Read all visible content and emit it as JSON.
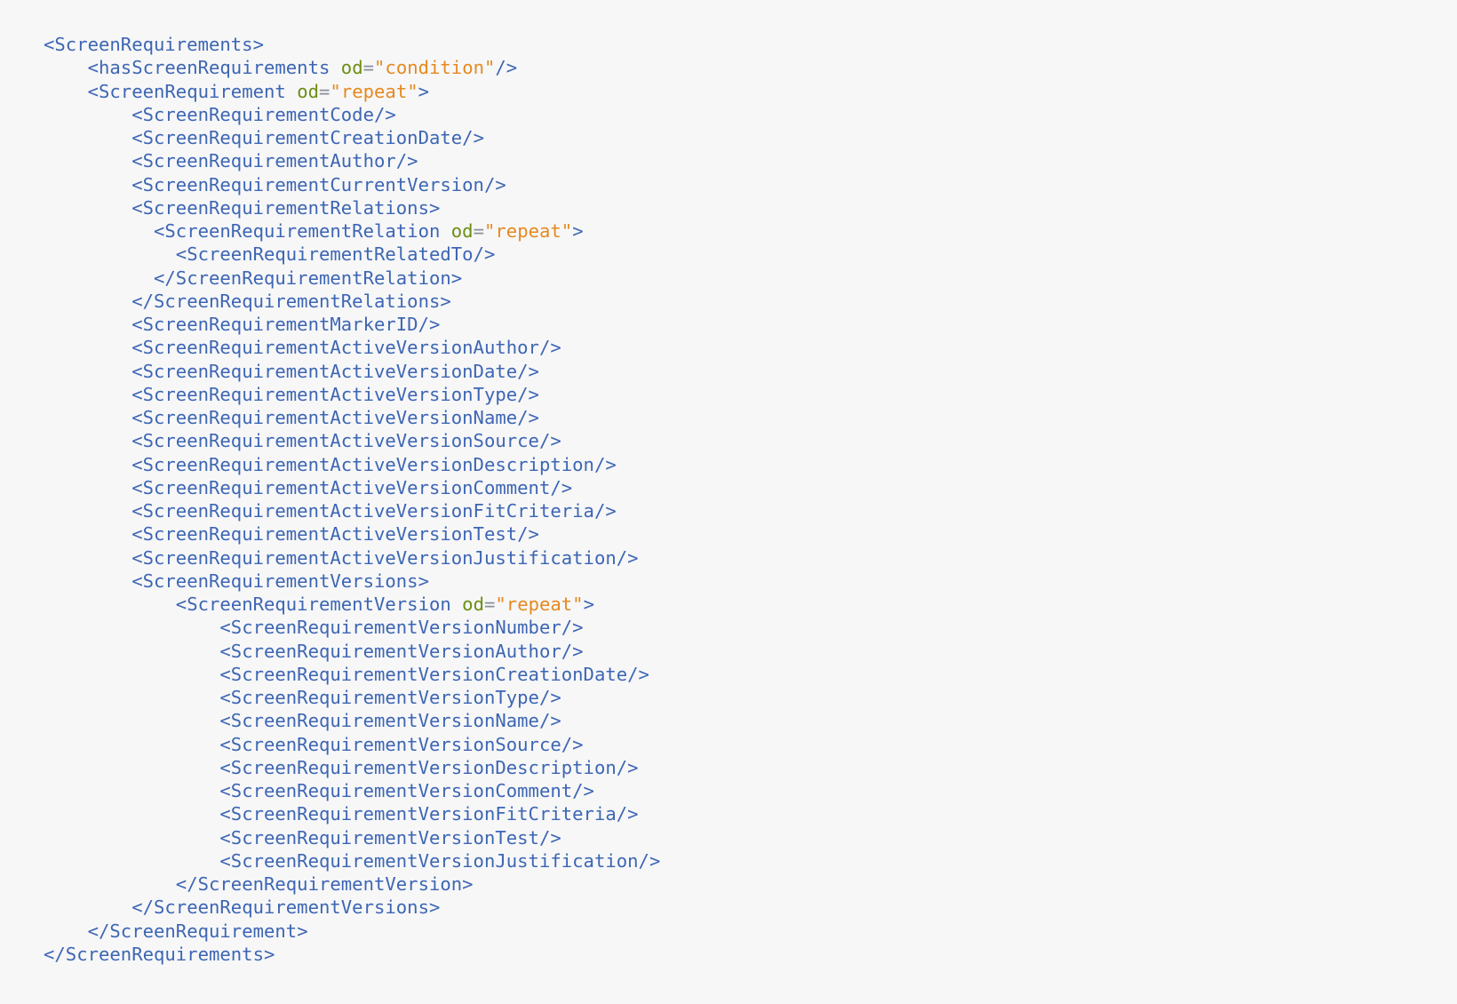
{
  "colors": {
    "background": "#f7f7f8",
    "tag": "#3d66b3",
    "attribute": "#6b8e12",
    "equals": "#8a8f99",
    "value": "#e6891f"
  },
  "code": {
    "language": "xml",
    "lines": [
      {
        "indent": 0,
        "open": "<ScreenRequirements",
        "close": ">"
      },
      {
        "indent": 4,
        "open": "<hasScreenRequirements",
        "attr": "od",
        "value": "\"condition\"",
        "close": "/>"
      },
      {
        "indent": 4,
        "open": "<ScreenRequirement",
        "attr": "od",
        "value": "\"repeat\"",
        "close": ">"
      },
      {
        "indent": 8,
        "open": "<ScreenRequirementCode",
        "close": "/>"
      },
      {
        "indent": 8,
        "open": "<ScreenRequirementCreationDate",
        "close": "/>"
      },
      {
        "indent": 8,
        "open": "<ScreenRequirementAuthor",
        "close": "/>"
      },
      {
        "indent": 8,
        "open": "<ScreenRequirementCurrentVersion",
        "close": "/>"
      },
      {
        "indent": 8,
        "open": "<ScreenRequirementRelations",
        "close": ">"
      },
      {
        "indent": 10,
        "open": "<ScreenRequirementRelation",
        "attr": "od",
        "value": "\"repeat\"",
        "close": ">"
      },
      {
        "indent": 12,
        "open": "<ScreenRequirementRelatedTo",
        "close": "/>"
      },
      {
        "indent": 10,
        "open": "</ScreenRequirementRelation",
        "close": ">"
      },
      {
        "indent": 8,
        "open": "</ScreenRequirementRelations",
        "close": ">"
      },
      {
        "indent": 8,
        "open": "<ScreenRequirementMarkerID",
        "close": "/>"
      },
      {
        "indent": 8,
        "open": "<ScreenRequirementActiveVersionAuthor",
        "close": "/>"
      },
      {
        "indent": 8,
        "open": "<ScreenRequirementActiveVersionDate",
        "close": "/>"
      },
      {
        "indent": 8,
        "open": "<ScreenRequirementActiveVersionType",
        "close": "/>"
      },
      {
        "indent": 8,
        "open": "<ScreenRequirementActiveVersionName",
        "close": "/>"
      },
      {
        "indent": 8,
        "open": "<ScreenRequirementActiveVersionSource",
        "close": "/>"
      },
      {
        "indent": 8,
        "open": "<ScreenRequirementActiveVersionDescription",
        "close": "/>"
      },
      {
        "indent": 8,
        "open": "<ScreenRequirementActiveVersionComment",
        "close": "/>"
      },
      {
        "indent": 8,
        "open": "<ScreenRequirementActiveVersionFitCriteria",
        "close": "/>"
      },
      {
        "indent": 8,
        "open": "<ScreenRequirementActiveVersionTest",
        "close": "/>"
      },
      {
        "indent": 8,
        "open": "<ScreenRequirementActiveVersionJustification",
        "close": "/>"
      },
      {
        "indent": 8,
        "open": "<ScreenRequirementVersions",
        "close": ">"
      },
      {
        "indent": 12,
        "open": "<ScreenRequirementVersion",
        "attr": "od",
        "value": "\"repeat\"",
        "close": ">"
      },
      {
        "indent": 16,
        "open": "<ScreenRequirementVersionNumber",
        "close": "/>"
      },
      {
        "indent": 16,
        "open": "<ScreenRequirementVersionAuthor",
        "close": "/>"
      },
      {
        "indent": 16,
        "open": "<ScreenRequirementVersionCreationDate",
        "close": "/>"
      },
      {
        "indent": 16,
        "open": "<ScreenRequirementVersionType",
        "close": "/>"
      },
      {
        "indent": 16,
        "open": "<ScreenRequirementVersionName",
        "close": "/>"
      },
      {
        "indent": 16,
        "open": "<ScreenRequirementVersionSource",
        "close": "/>"
      },
      {
        "indent": 16,
        "open": "<ScreenRequirementVersionDescription",
        "close": "/>"
      },
      {
        "indent": 16,
        "open": "<ScreenRequirementVersionComment",
        "close": "/>"
      },
      {
        "indent": 16,
        "open": "<ScreenRequirementVersionFitCriteria",
        "close": "/>"
      },
      {
        "indent": 16,
        "open": "<ScreenRequirementVersionTest",
        "close": "/>"
      },
      {
        "indent": 16,
        "open": "<ScreenRequirementVersionJustification",
        "close": "/>"
      },
      {
        "indent": 12,
        "open": "</ScreenRequirementVersion",
        "close": ">"
      },
      {
        "indent": 8,
        "open": "</ScreenRequirementVersions",
        "close": ">"
      },
      {
        "indent": 4,
        "open": "</ScreenRequirement",
        "close": ">"
      },
      {
        "indent": 0,
        "open": "</ScreenRequirements",
        "close": ">"
      }
    ]
  }
}
